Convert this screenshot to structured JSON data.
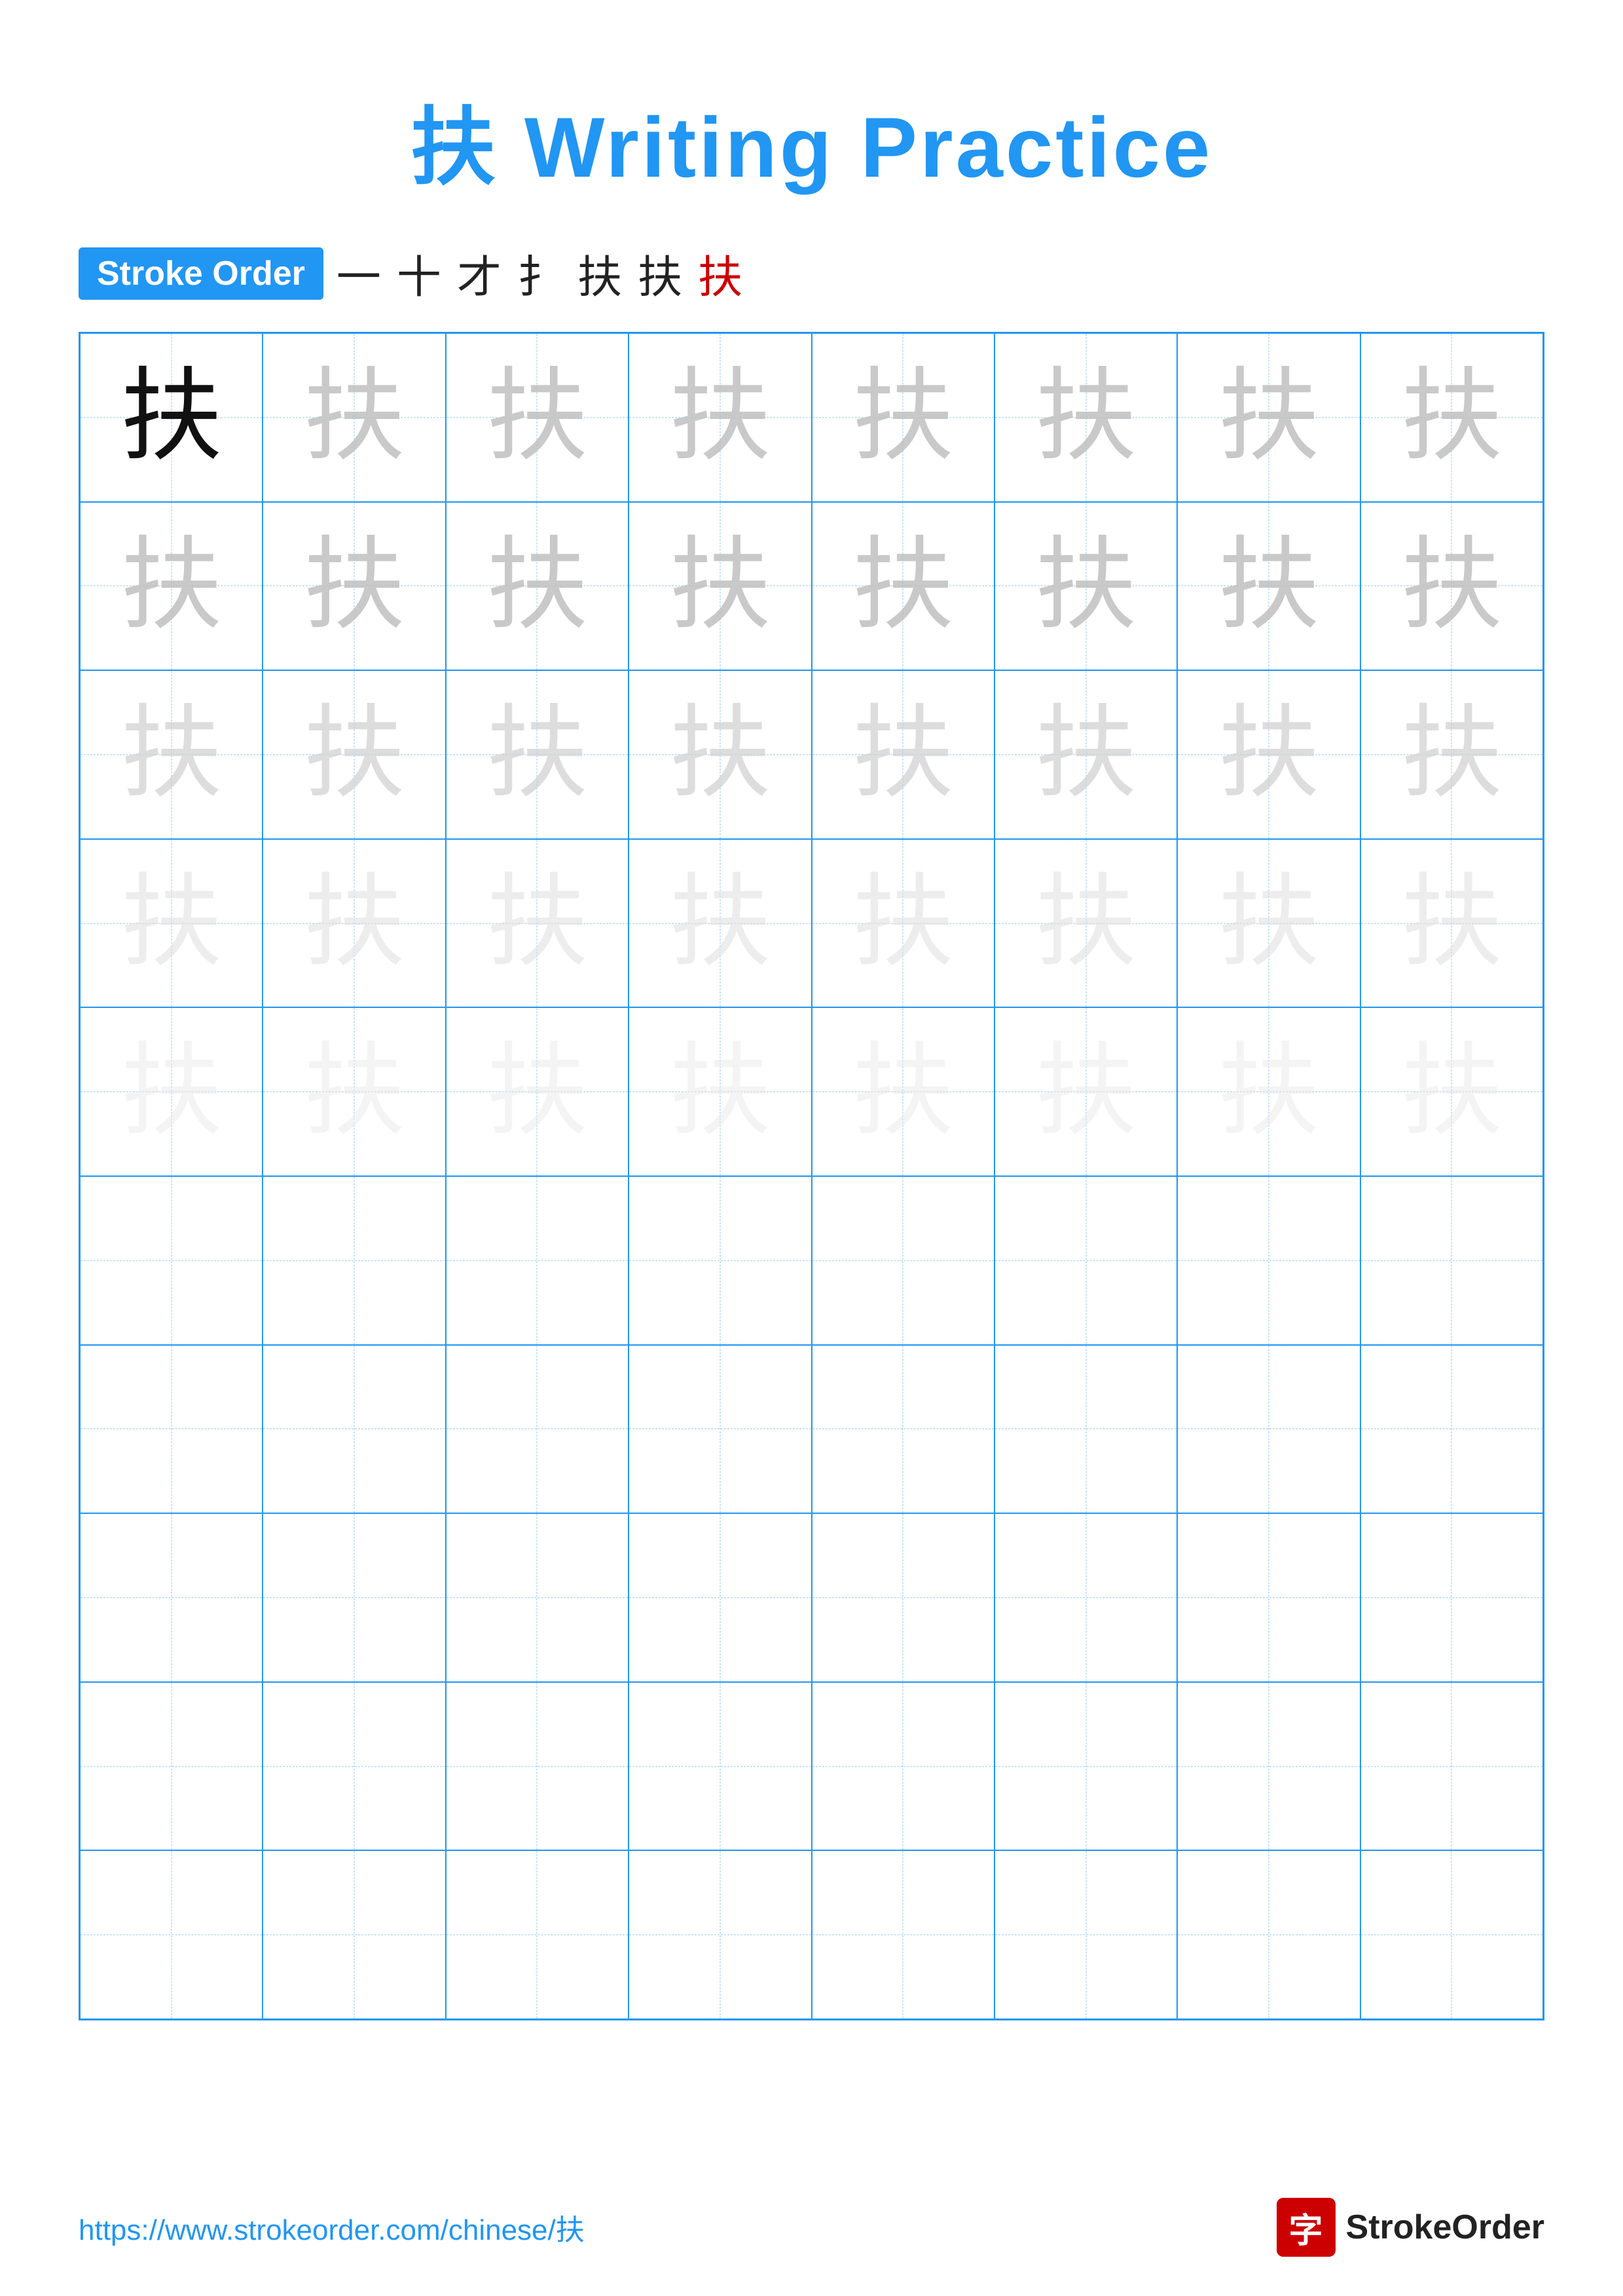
{
  "title": "扶 Writing Practice",
  "stroke_order": {
    "badge_label": "Stroke Order",
    "strokes": [
      "一",
      "十",
      "才",
      "扌",
      "扶",
      "扶",
      "扶"
    ]
  },
  "grid": {
    "rows": 10,
    "cols": 8,
    "character": "扶"
  },
  "footer": {
    "url": "https://www.strokeorder.com/chinese/扶",
    "logo_char": "字",
    "logo_text": "StrokeOrder"
  },
  "colors": {
    "blue": "#2196F3",
    "red": "#cc0000",
    "light_blue": "#90CAF9",
    "dark": "#111",
    "gray1": "#c0c0c0",
    "gray2": "#d0d0d0",
    "gray3": "#e0e0e0",
    "gray4": "#e8e8e8"
  }
}
